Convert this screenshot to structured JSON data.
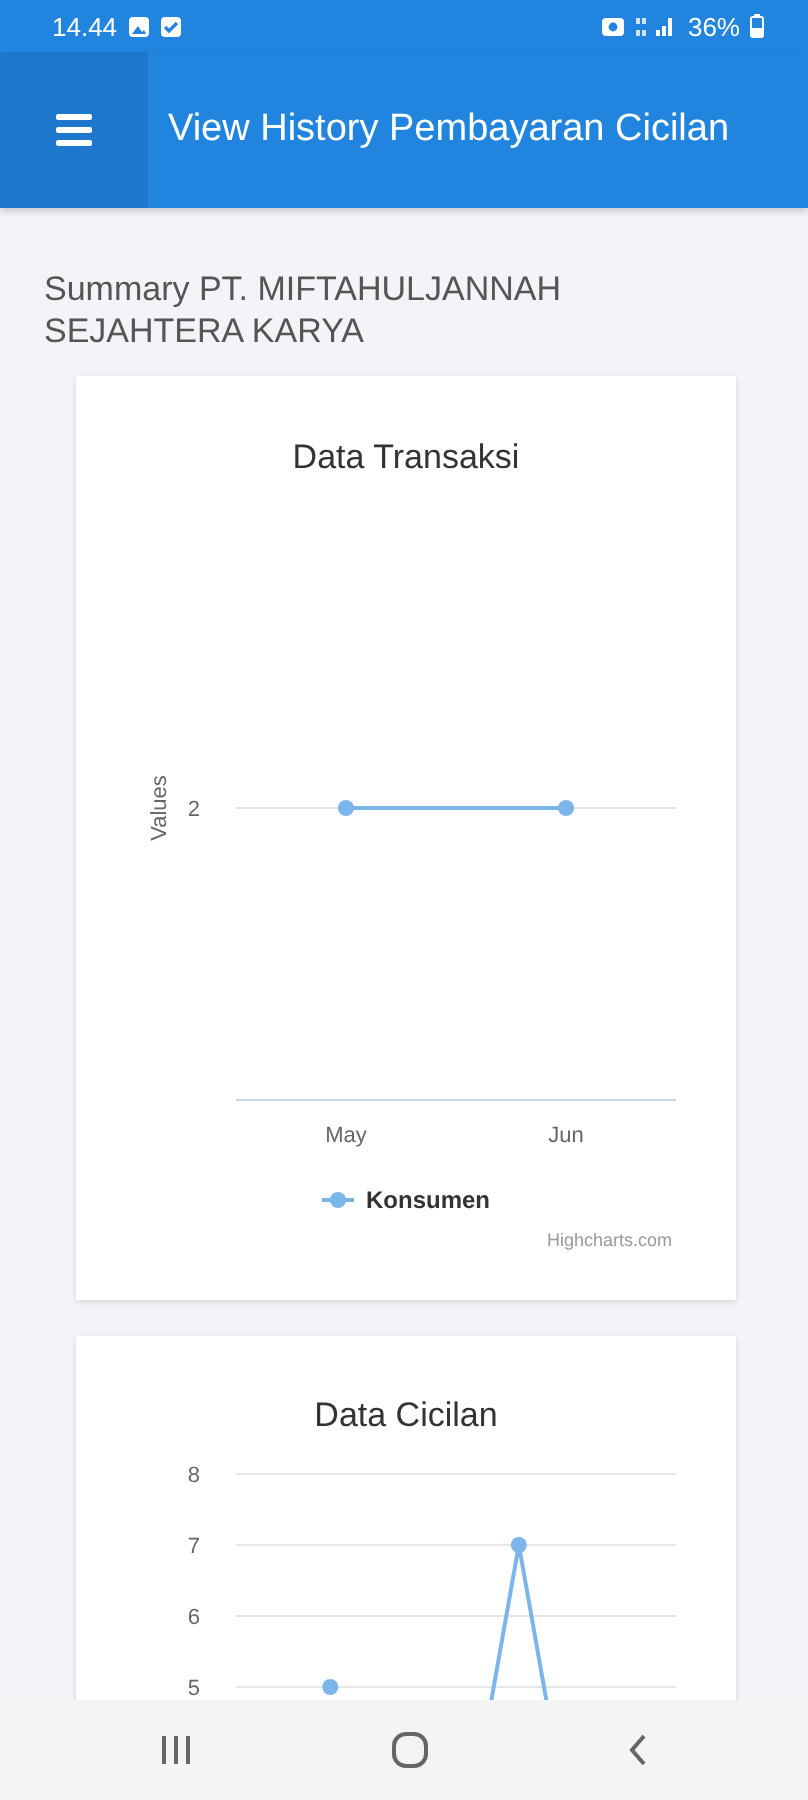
{
  "status_bar": {
    "time": "14.44",
    "battery": "36%"
  },
  "app_bar": {
    "title": "View History Pembayaran Cicilan"
  },
  "summary": "Summary PT. MIFTAHULJANNAH SEJAHTERA KARYA",
  "charts": [
    {
      "title": "Data Transaksi",
      "y_axis_title": "Values",
      "y_axis_label": "2",
      "x_axis_labels": [
        "May",
        "Jun"
      ],
      "legend": [
        {
          "name": "Konsumen",
          "color": "#7cb5ec"
        }
      ],
      "credits": "Highcharts.com"
    },
    {
      "chart_data": {
        "type": "line",
        "title": "Data Cicilan",
        "categories": [
          null,
          null,
          null,
          null,
          null,
          null,
          null
        ],
        "series": [
          {
            "color": "#7cb5ec",
            "marker": true,
            "values": [
              null,
              5,
              null,
              null,
              7,
              null,
              null
            ]
          }
        ],
        "ylim": [
          5,
          8
        ],
        "yticks": [
          5,
          6,
          7,
          8
        ]
      }
    }
  ]
}
